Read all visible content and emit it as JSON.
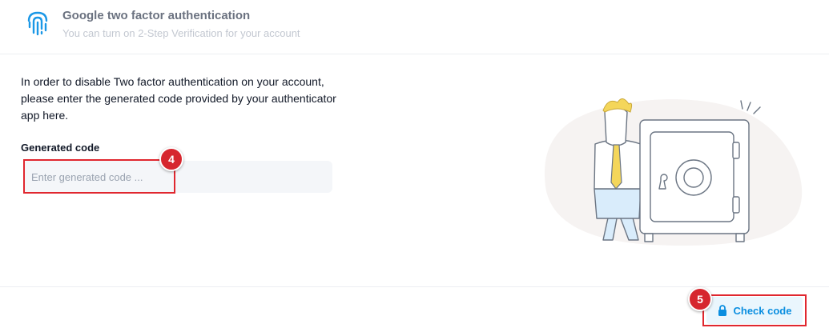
{
  "header": {
    "title": "Google two factor authentication",
    "subtitle": "You can turn on 2-Step Verification for your account",
    "icon": "fingerprint-icon"
  },
  "form": {
    "description": "In order to disable Two factor authentication on your account, please enter the generated code provided by your authenticator app here.",
    "code_label": "Generated code",
    "code_value": "",
    "code_placeholder": "Enter generated code ..."
  },
  "footer": {
    "check_label": "Check code",
    "check_icon": "lock-icon"
  },
  "annotations": {
    "step_input": "4",
    "step_button": "5"
  },
  "colors": {
    "accent": "#0a8ee0",
    "highlight": "#e0272f"
  }
}
